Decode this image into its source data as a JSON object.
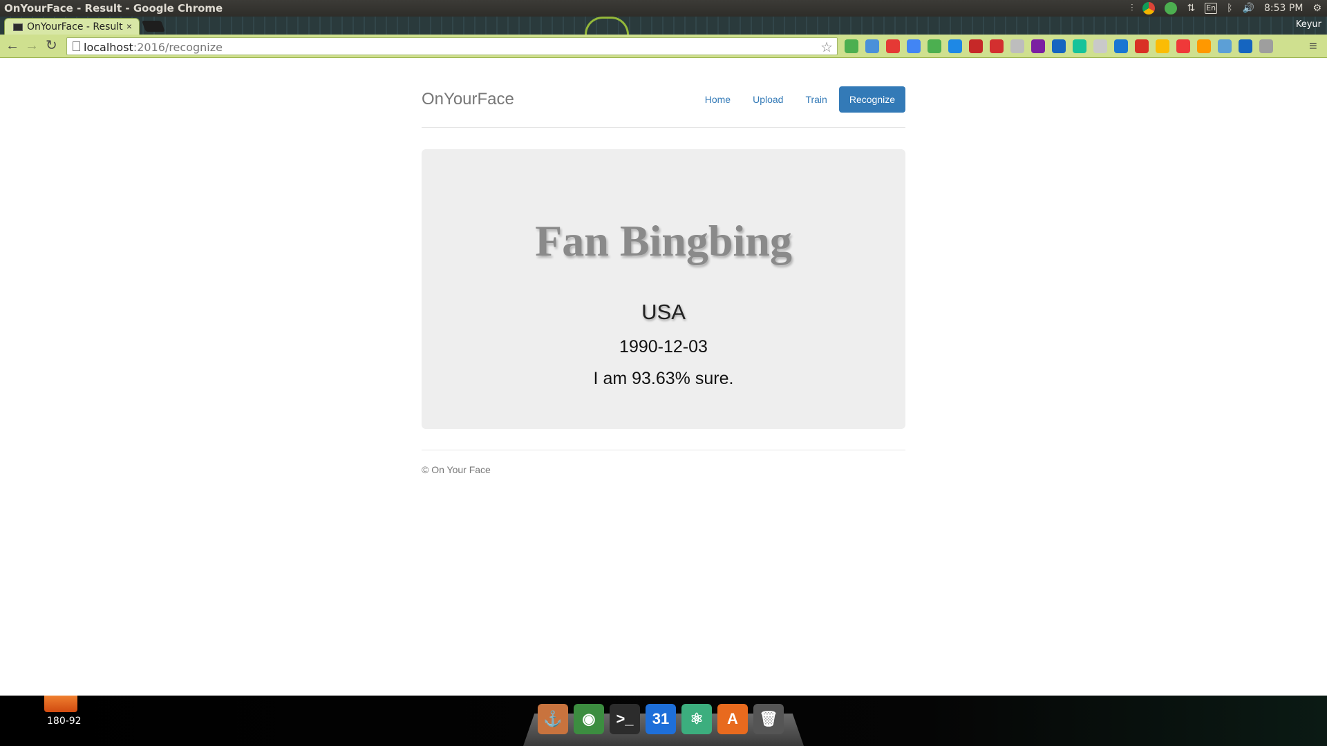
{
  "os": {
    "window_title": "OnYourFace - Result - Google Chrome",
    "keyboard_layout": "En",
    "clock": "8:53 PM",
    "user": "Keyur"
  },
  "browser": {
    "tab_title": "OnYourFace - Result",
    "tab_close": "×",
    "url_host": "localhost",
    "url_rest": ":2016/recognize",
    "back_glyph": "←",
    "forward_glyph": "→",
    "reload_glyph": "↻",
    "star_glyph": "☆",
    "menu_glyph": "≡",
    "extensions": [
      {
        "name": "hangouts-icon",
        "color": "#4caf50"
      },
      {
        "name": "font-icon",
        "color": "#4a90d9"
      },
      {
        "name": "bookmark-icon",
        "color": "#e53935"
      },
      {
        "name": "translate-icon",
        "color": "#4285f4"
      },
      {
        "name": "pushbullet-icon",
        "color": "#4caf50"
      },
      {
        "name": "window-icon",
        "color": "#1e88e5"
      },
      {
        "name": "couch-icon",
        "color": "#c62828"
      },
      {
        "name": "adblock-icon",
        "color": "#d32f2f"
      },
      {
        "name": "puzzle-icon",
        "color": "#bdbdbd"
      },
      {
        "name": "onenote-icon",
        "color": "#7b1fa2"
      },
      {
        "name": "dashlane-icon",
        "color": "#1565c0"
      },
      {
        "name": "grammarly-icon",
        "color": "#15c39a"
      },
      {
        "name": "circle-icon",
        "color": "#c9c9c9"
      },
      {
        "name": "stack-icon",
        "color": "#1976d2"
      },
      {
        "name": "gmail-icon",
        "color": "#d93025"
      },
      {
        "name": "drive-icon",
        "color": "#fbbc04"
      },
      {
        "name": "vivaldi-icon",
        "color": "#ef3939"
      },
      {
        "name": "carrot-icon",
        "color": "#ff9800"
      },
      {
        "name": "diamond-icon",
        "color": "#5c9fd6"
      },
      {
        "name": "flag-icon",
        "color": "#1565c0"
      },
      {
        "name": "image-icon",
        "color": "#9e9e9e"
      }
    ]
  },
  "site": {
    "brand": "OnYourFace",
    "nav": [
      "Home",
      "Upload",
      "Train",
      "Recognize"
    ],
    "result": {
      "name": "Fan Bingbing",
      "country": "USA",
      "dob": "1990-12-03",
      "confidence_text": "I am 93.63% sure."
    },
    "footer": "© On Your Face"
  },
  "dock": {
    "desktop_label": "180-92",
    "apps": [
      {
        "name": "anchor-app-icon",
        "glyph": "⚓",
        "color": "#c8733e"
      },
      {
        "name": "chrome-app-icon",
        "glyph": "◉",
        "color": "#3c8d40"
      },
      {
        "name": "terminal-app-icon",
        "glyph": ">_",
        "color": "#2c2c2c"
      },
      {
        "name": "calendar-app-icon",
        "glyph": "31",
        "color": "#1e6fd9"
      },
      {
        "name": "atom-app-icon",
        "glyph": "⚛",
        "color": "#3cae7e"
      },
      {
        "name": "software-center-app-icon",
        "glyph": "A",
        "color": "#e86a1e"
      },
      {
        "name": "trash-app-icon",
        "glyph": "🗑",
        "color": "#555555"
      }
    ]
  }
}
